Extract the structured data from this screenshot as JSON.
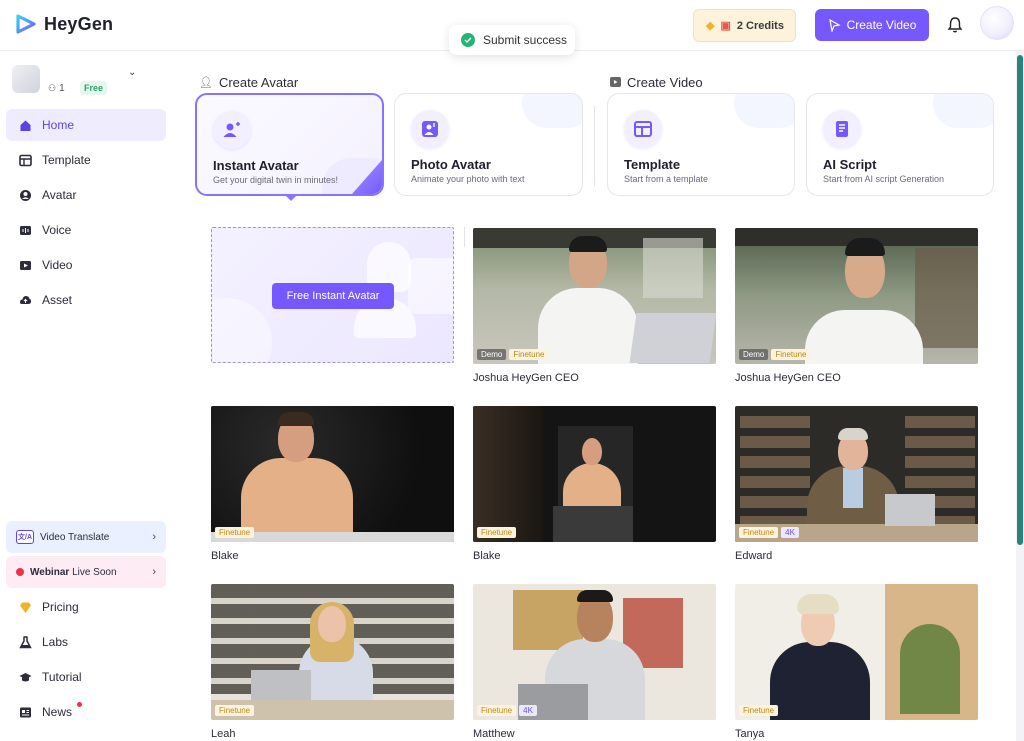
{
  "app": {
    "name": "HeyGen"
  },
  "toast": {
    "text": "Submit success"
  },
  "header": {
    "credits": "2 Credits",
    "create_video": "Create Video"
  },
  "workspace": {
    "members": "1",
    "plan": "Free"
  },
  "sidebar": {
    "items": [
      {
        "label": "Home",
        "icon": "home-icon"
      },
      {
        "label": "Template",
        "icon": "template-icon"
      },
      {
        "label": "Avatar",
        "icon": "avatar-icon"
      },
      {
        "label": "Voice",
        "icon": "voice-icon"
      },
      {
        "label": "Video",
        "icon": "video-icon"
      },
      {
        "label": "Asset",
        "icon": "asset-icon"
      }
    ],
    "promos": {
      "video_translate": "Video Translate",
      "webinar_bold": "Webinar",
      "webinar_rest": "Live Soon"
    },
    "bottom": [
      {
        "label": "Pricing",
        "icon": "diamond-icon"
      },
      {
        "label": "Labs",
        "icon": "flask-icon"
      },
      {
        "label": "Tutorial",
        "icon": "graduation-cap-icon"
      },
      {
        "label": "News",
        "icon": "news-icon"
      }
    ]
  },
  "sections": {
    "create_avatar": "Create Avatar",
    "create_video": "Create Video"
  },
  "cards": [
    {
      "title": "Instant Avatar",
      "sub": "Get your digital twin in minutes!"
    },
    {
      "title": "Photo Avatar",
      "sub": "Animate your photo with text"
    },
    {
      "title": "Template",
      "sub": "Start from a template"
    },
    {
      "title": "AI Script",
      "sub": "Start from AI script Generation"
    }
  ],
  "placeholder": {
    "button": "Free Instant Avatar"
  },
  "avatars": [
    {
      "name": "Joshua HeyGen CEO",
      "badges": [
        "Demo",
        "Finetune"
      ]
    },
    {
      "name": "Joshua HeyGen CEO",
      "badges": [
        "Demo",
        "Finetune"
      ]
    },
    {
      "name": "Blake",
      "badges": [
        "Finetune"
      ]
    },
    {
      "name": "Blake",
      "badges": [
        "Finetune"
      ]
    },
    {
      "name": "Edward",
      "badges": [
        "Finetune",
        "4K"
      ]
    },
    {
      "name": "Leah",
      "badges": [
        "Finetune"
      ]
    },
    {
      "name": "Matthew",
      "badges": [
        "Finetune",
        "4K"
      ]
    },
    {
      "name": "Tanya",
      "badges": [
        "Finetune"
      ]
    }
  ],
  "colors": {
    "accent": "#7559ff",
    "active_bg": "#efedfd",
    "success": "#22b573"
  }
}
